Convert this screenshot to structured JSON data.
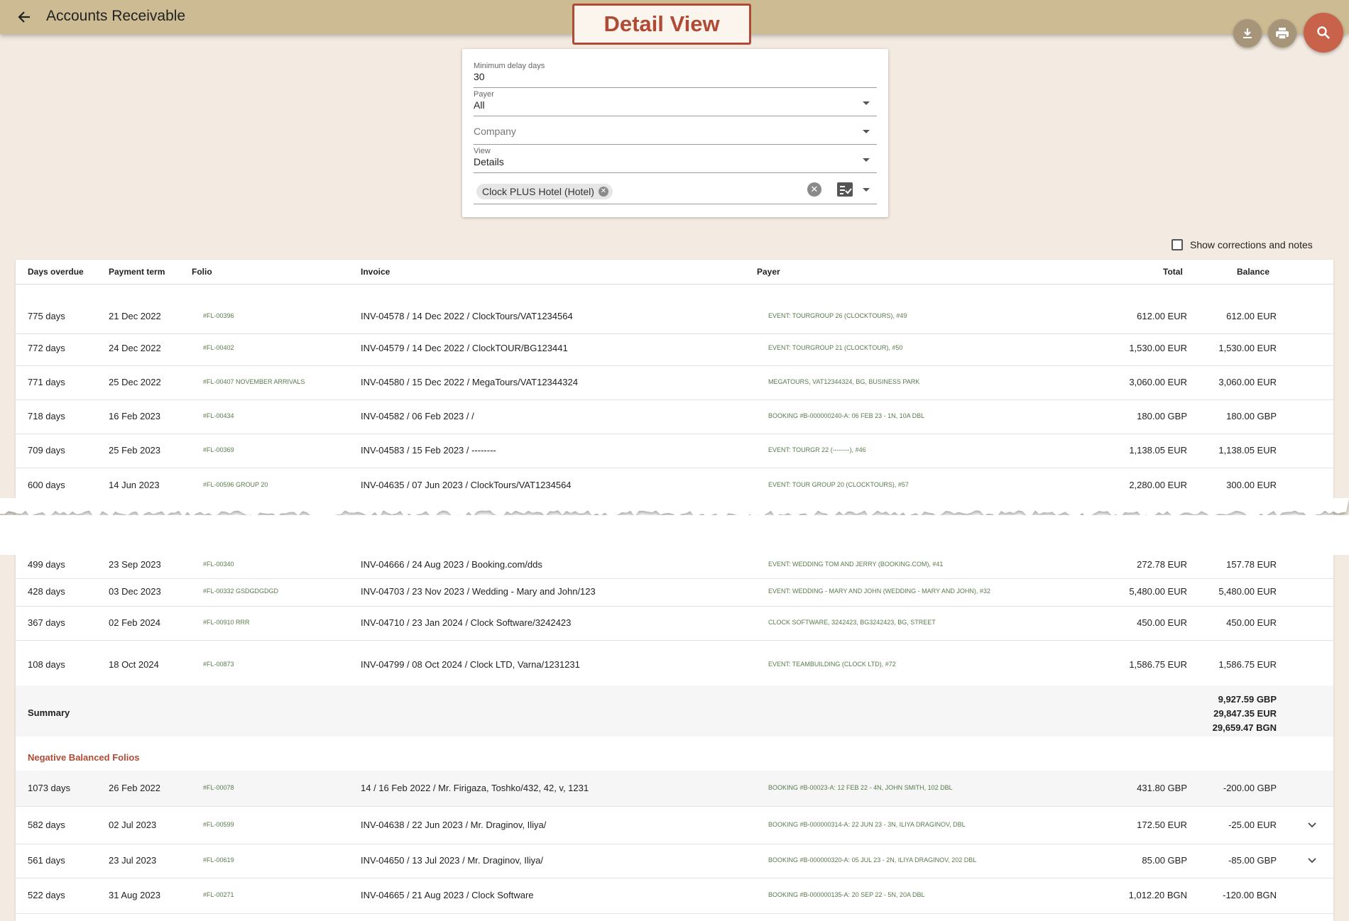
{
  "header": {
    "title": "Accounts Receivable",
    "banner": "Detail View",
    "brand_color": "#cdbb94",
    "accent_color": "#b14a35"
  },
  "actions": {
    "download_icon": "download-icon",
    "print_icon": "print-icon",
    "search_icon": "search-icon"
  },
  "filters": {
    "min_delay": {
      "label": "Minimum delay days",
      "value": "30"
    },
    "payer": {
      "label": "Payer",
      "value": "All"
    },
    "company": {
      "placeholder": "Company"
    },
    "view": {
      "label": "View",
      "value": "Details"
    },
    "property_chip": "Clock PLUS Hotel (Hotel)"
  },
  "show_corrections_label": "Show corrections and notes",
  "table": {
    "columns": [
      "Days overdue",
      "Payment term",
      "Folio",
      "Invoice",
      "Payer",
      "Total",
      "Balance"
    ],
    "rows": [
      {
        "days": "775 days",
        "term": "21 Dec 2022",
        "folio": "#FL-00396",
        "invoice": "INV-04578 / 14 Dec 2022 / ClockTours/VAT1234564",
        "payer": "EVENT: TOURGROUP 26 (CLOCKTOURS), #49",
        "total": "612.00 EUR",
        "balance": "612.00 EUR"
      },
      {
        "days": "772 days",
        "term": "24 Dec 2022",
        "folio": "#FL-00402",
        "invoice": "INV-04579 / 14 Dec 2022 / ClockTOUR/BG123441",
        "payer": "EVENT: TOURGROUP 21 (CLOCKTOUR), #50",
        "total": "1,530.00 EUR",
        "balance": "1,530.00 EUR"
      },
      {
        "days": "771 days",
        "term": "25 Dec 2022",
        "folio": "#FL-00407 NOVEMBER ARRIVALS",
        "invoice": "INV-04580 / 15 Dec 2022 / MegaTours/VAT12344324",
        "payer": "MEGATOURS, VAT12344324, BG, BUSINESS PARK",
        "total": "3,060.00 EUR",
        "balance": "3,060.00 EUR"
      },
      {
        "days": "718 days",
        "term": "16 Feb 2023",
        "folio": "#FL-00434",
        "invoice": "INV-04582 / 06 Feb 2023 / /",
        "payer": "BOOKING #B-000000240-A: 06 FEB 23 - 1N, 10A DBL",
        "total": "180.00 GBP",
        "balance": "180.00 GBP"
      },
      {
        "days": "709 days",
        "term": "25 Feb 2023",
        "folio": "#FL-00369",
        "invoice": "INV-04583 / 15 Feb 2023 / --------",
        "payer": "EVENT: TOURGR 22 (--------), #46",
        "total": "1,138.05 EUR",
        "balance": "1,138.05 EUR"
      },
      {
        "days": "600 days",
        "term": "14 Jun 2023",
        "folio": "#FL-00596 GROUP 20",
        "invoice": "INV-04635 / 07 Jun 2023 / ClockTours/VAT1234564",
        "payer": "EVENT: TOUR GROUP 20 (CLOCKTOURS), #57",
        "total": "2,280.00 EUR",
        "balance": "300.00 EUR"
      },
      {
        "days": "499 days",
        "term": "23 Sep 2023",
        "folio": "#FL-00340",
        "invoice": "INV-04666 / 24 Aug 2023 / Booking.com/dds",
        "payer": "EVENT: WEDDING TOM AND JERRY (BOOKING.COM), #41",
        "total": "272.78 EUR",
        "balance": "157.78 EUR"
      },
      {
        "days": "428 days",
        "term": "03 Dec 2023",
        "folio": "#FL-00332 GSDGDGDGD",
        "invoice": "INV-04703 / 23 Nov 2023 / Wedding - Mary and John/123",
        "payer": "EVENT: WEDDING - MARY AND JOHN (WEDDING - MARY AND JOHN), #32",
        "total": "5,480.00 EUR",
        "balance": "5,480.00 EUR"
      },
      {
        "days": "367 days",
        "term": "02 Feb 2024",
        "folio": "#FL-00910 RRR",
        "invoice": "INV-04710 / 23 Jan 2024 / Clock Software/3242423",
        "payer": "CLOCK SOFTWARE, 3242423, BG3242423, BG, STREET",
        "total": "450.00 EUR",
        "balance": "450.00 EUR"
      },
      {
        "days": "108 days",
        "term": "18 Oct 2024",
        "folio": "#FL-00873",
        "invoice": "INV-04799 / 08 Oct 2024 / Clock LTD, Varna/1231231",
        "payer": "EVENT: TEAMBUILDING (CLOCK LTD), #72",
        "total": "1,586.75 EUR",
        "balance": "1,586.75 EUR"
      }
    ],
    "summary": {
      "label": "Summary",
      "values": [
        "9,927.59 GBP",
        "29,847.35 EUR",
        "29,659.47 BGN"
      ]
    },
    "negative_title": "Negative Balanced Folios",
    "negative_rows": [
      {
        "days": "1073 days",
        "term": "26 Feb 2022",
        "folio": "#FL-00078",
        "invoice": "14 / 16 Feb 2022 / Mr. Firigaza, Toshko/432, 42, v, 1231",
        "payer": "BOOKING #B-00023-A: 12 FEB 22 - 4N, JOHN SMITH, 102 DBL",
        "total": "431.80 GBP",
        "balance": "-200.00 GBP"
      },
      {
        "days": "582 days",
        "term": "02 Jul 2023",
        "folio": "#FL-00599",
        "invoice": "INV-04638 / 22 Jun 2023 / Mr. Draginov, Iliya/",
        "payer": "BOOKING #B-000000314-A: 22 JUN 23 - 3N, ILIYA DRAGINOV, DBL",
        "total": "172.50 EUR",
        "balance": "-25.00 EUR"
      },
      {
        "days": "561 days",
        "term": "23 Jul 2023",
        "folio": "#FL-00619",
        "invoice": "INV-04650 / 13 Jul 2023 / Mr. Draginov, Iliya/",
        "payer": "BOOKING #B-000000320-A: 05 JUL 23 - 2N, ILIYA DRAGINOV, 202 DBL",
        "total": "85.00 GBP",
        "balance": "-85.00 GBP"
      },
      {
        "days": "522 days",
        "term": "31 Aug 2023",
        "folio": "#FL-00271",
        "invoice": "INV-04665 / 21 Aug 2023 / Clock Software",
        "payer": "BOOKING #B-000000135-A: 20 SEP 22 - 5N, 20A DBL",
        "total": "1,012.20 BGN",
        "balance": "-120.00 BGN"
      }
    ]
  }
}
